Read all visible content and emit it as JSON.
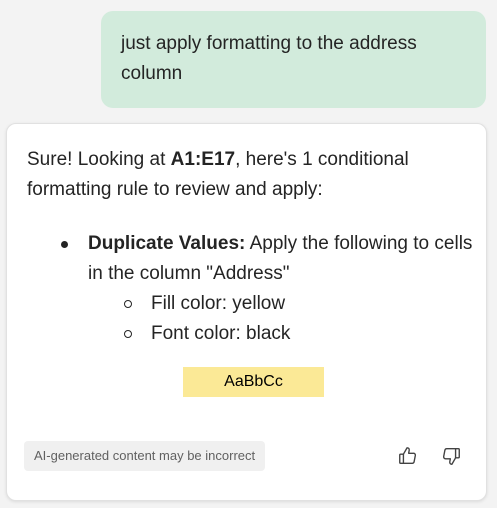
{
  "user_message": {
    "text": "just apply formatting to the address column"
  },
  "reply": {
    "intro_prefix": "Sure! Looking at ",
    "range": "A1:E17",
    "intro_suffix": ", here's 1 conditional formatting rule to review and apply:",
    "rules": [
      {
        "title": "Duplicate Values:",
        "description": " Apply the following to cells in the column \"Address\"",
        "details": [
          "Fill color: yellow",
          "Font color: black"
        ]
      }
    ],
    "preview": {
      "label": "AaBbCc",
      "fill_color": "#fbe996",
      "font_color": "#000000"
    }
  },
  "footer": {
    "disclaimer": "AI-generated content may be incorrect",
    "actions": [
      "thumbs-up-icon",
      "thumbs-down-icon"
    ]
  },
  "colors": {
    "user_bubble": "#d2ebdc",
    "card_background": "#ffffff",
    "page_background": "#f3f3f3"
  }
}
